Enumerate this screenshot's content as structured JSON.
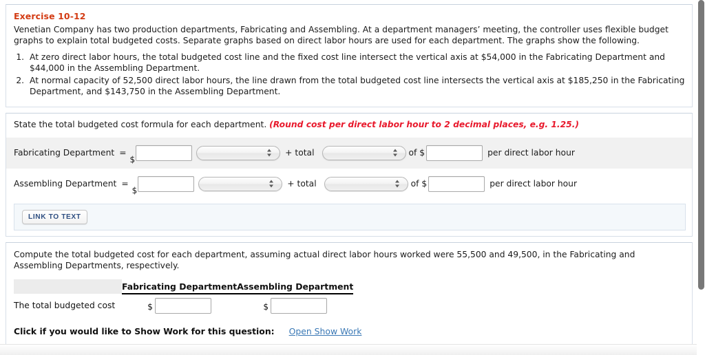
{
  "exercise": {
    "title": "Exercise 10-12",
    "intro": "Venetian Company has two production departments, Fabricating and Assembling. At a department managers’ meeting, the controller uses flexible budget graphs to explain total budgeted costs. Separate graphs based on direct labor hours are used for each department. The graphs show the following.",
    "facts": [
      "At zero direct labor hours, the total budgeted cost line and the fixed cost line intersect the vertical axis at $54,000 in the Fabricating Department and $44,000 in the Assembling Department.",
      "At normal capacity of 52,500 direct labor hours, the line drawn from the total budgeted cost line intersects the vertical axis at $185,250 in the Fabricating Department, and $143,750 in the Assembling Department."
    ]
  },
  "formula_section": {
    "prompt": "State the total budgeted cost formula for each department.",
    "rounding_note": "(Round cost per direct labor hour to 2 decimal places, e.g. 1.25.)",
    "rows": [
      {
        "label": "Fabricating Department",
        "equals": "=",
        "dollar_sign": "$",
        "amount_value": "",
        "select_value": "",
        "plus_total": "+ total",
        "select2_value": "",
        "of_dollar": "of $",
        "rate_value": "",
        "suffix": "per direct labor hour"
      },
      {
        "label": "Assembling Department",
        "equals": "=",
        "dollar_sign": "$",
        "amount_value": "",
        "select_value": "",
        "plus_total": "+ total",
        "select2_value": "",
        "of_dollar": "of $",
        "rate_value": "",
        "suffix": "per direct labor hour"
      }
    ],
    "link_to_text_label": "LINK TO TEXT"
  },
  "compute_section": {
    "prompt": "Compute the total budgeted cost for each department, assuming actual direct labor hours worked were 55,500 and 49,500, in the Fabricating and Assembling Departments, respectively.",
    "table": {
      "blank_header": "",
      "headers": [
        "Fabricating Department",
        "Assembling Department"
      ],
      "row_label": "The total budgeted cost",
      "dollar_sign": "$",
      "values": [
        "",
        ""
      ]
    },
    "show_work_label": "Click if you would like to Show Work for this question:",
    "show_work_link": "Open Show Work"
  },
  "colors": {
    "title_red": "#d33b13",
    "note_red": "#e8192c",
    "link_blue": "#3a78b5",
    "button_text_blue": "#2f4f82",
    "scrollbar": "#787878"
  }
}
